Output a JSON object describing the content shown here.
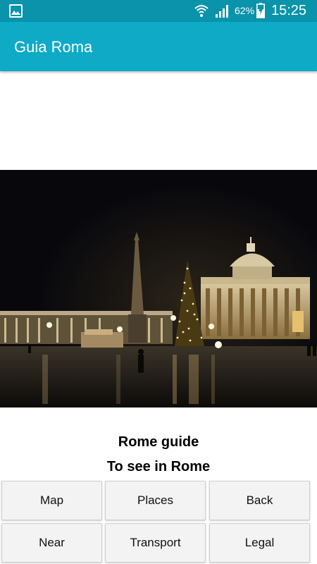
{
  "status_bar": {
    "battery_percent": "62%",
    "time": "15:25",
    "icons": [
      "gallery-icon",
      "wifi-icon",
      "signal-icon",
      "battery-charging-icon"
    ]
  },
  "app_bar": {
    "title": "Guia Roma"
  },
  "photo": {
    "icon": "st-peters-square-night-photo"
  },
  "headings": {
    "line1": "Rome guide",
    "line2": "To see in Rome"
  },
  "buttons": {
    "map": "Map",
    "places": "Places",
    "back": "Back",
    "near": "Near",
    "transport": "Transport",
    "legal": "Legal"
  },
  "colors": {
    "status_bar": "#0a93ab",
    "app_bar": "#0eaac6"
  }
}
